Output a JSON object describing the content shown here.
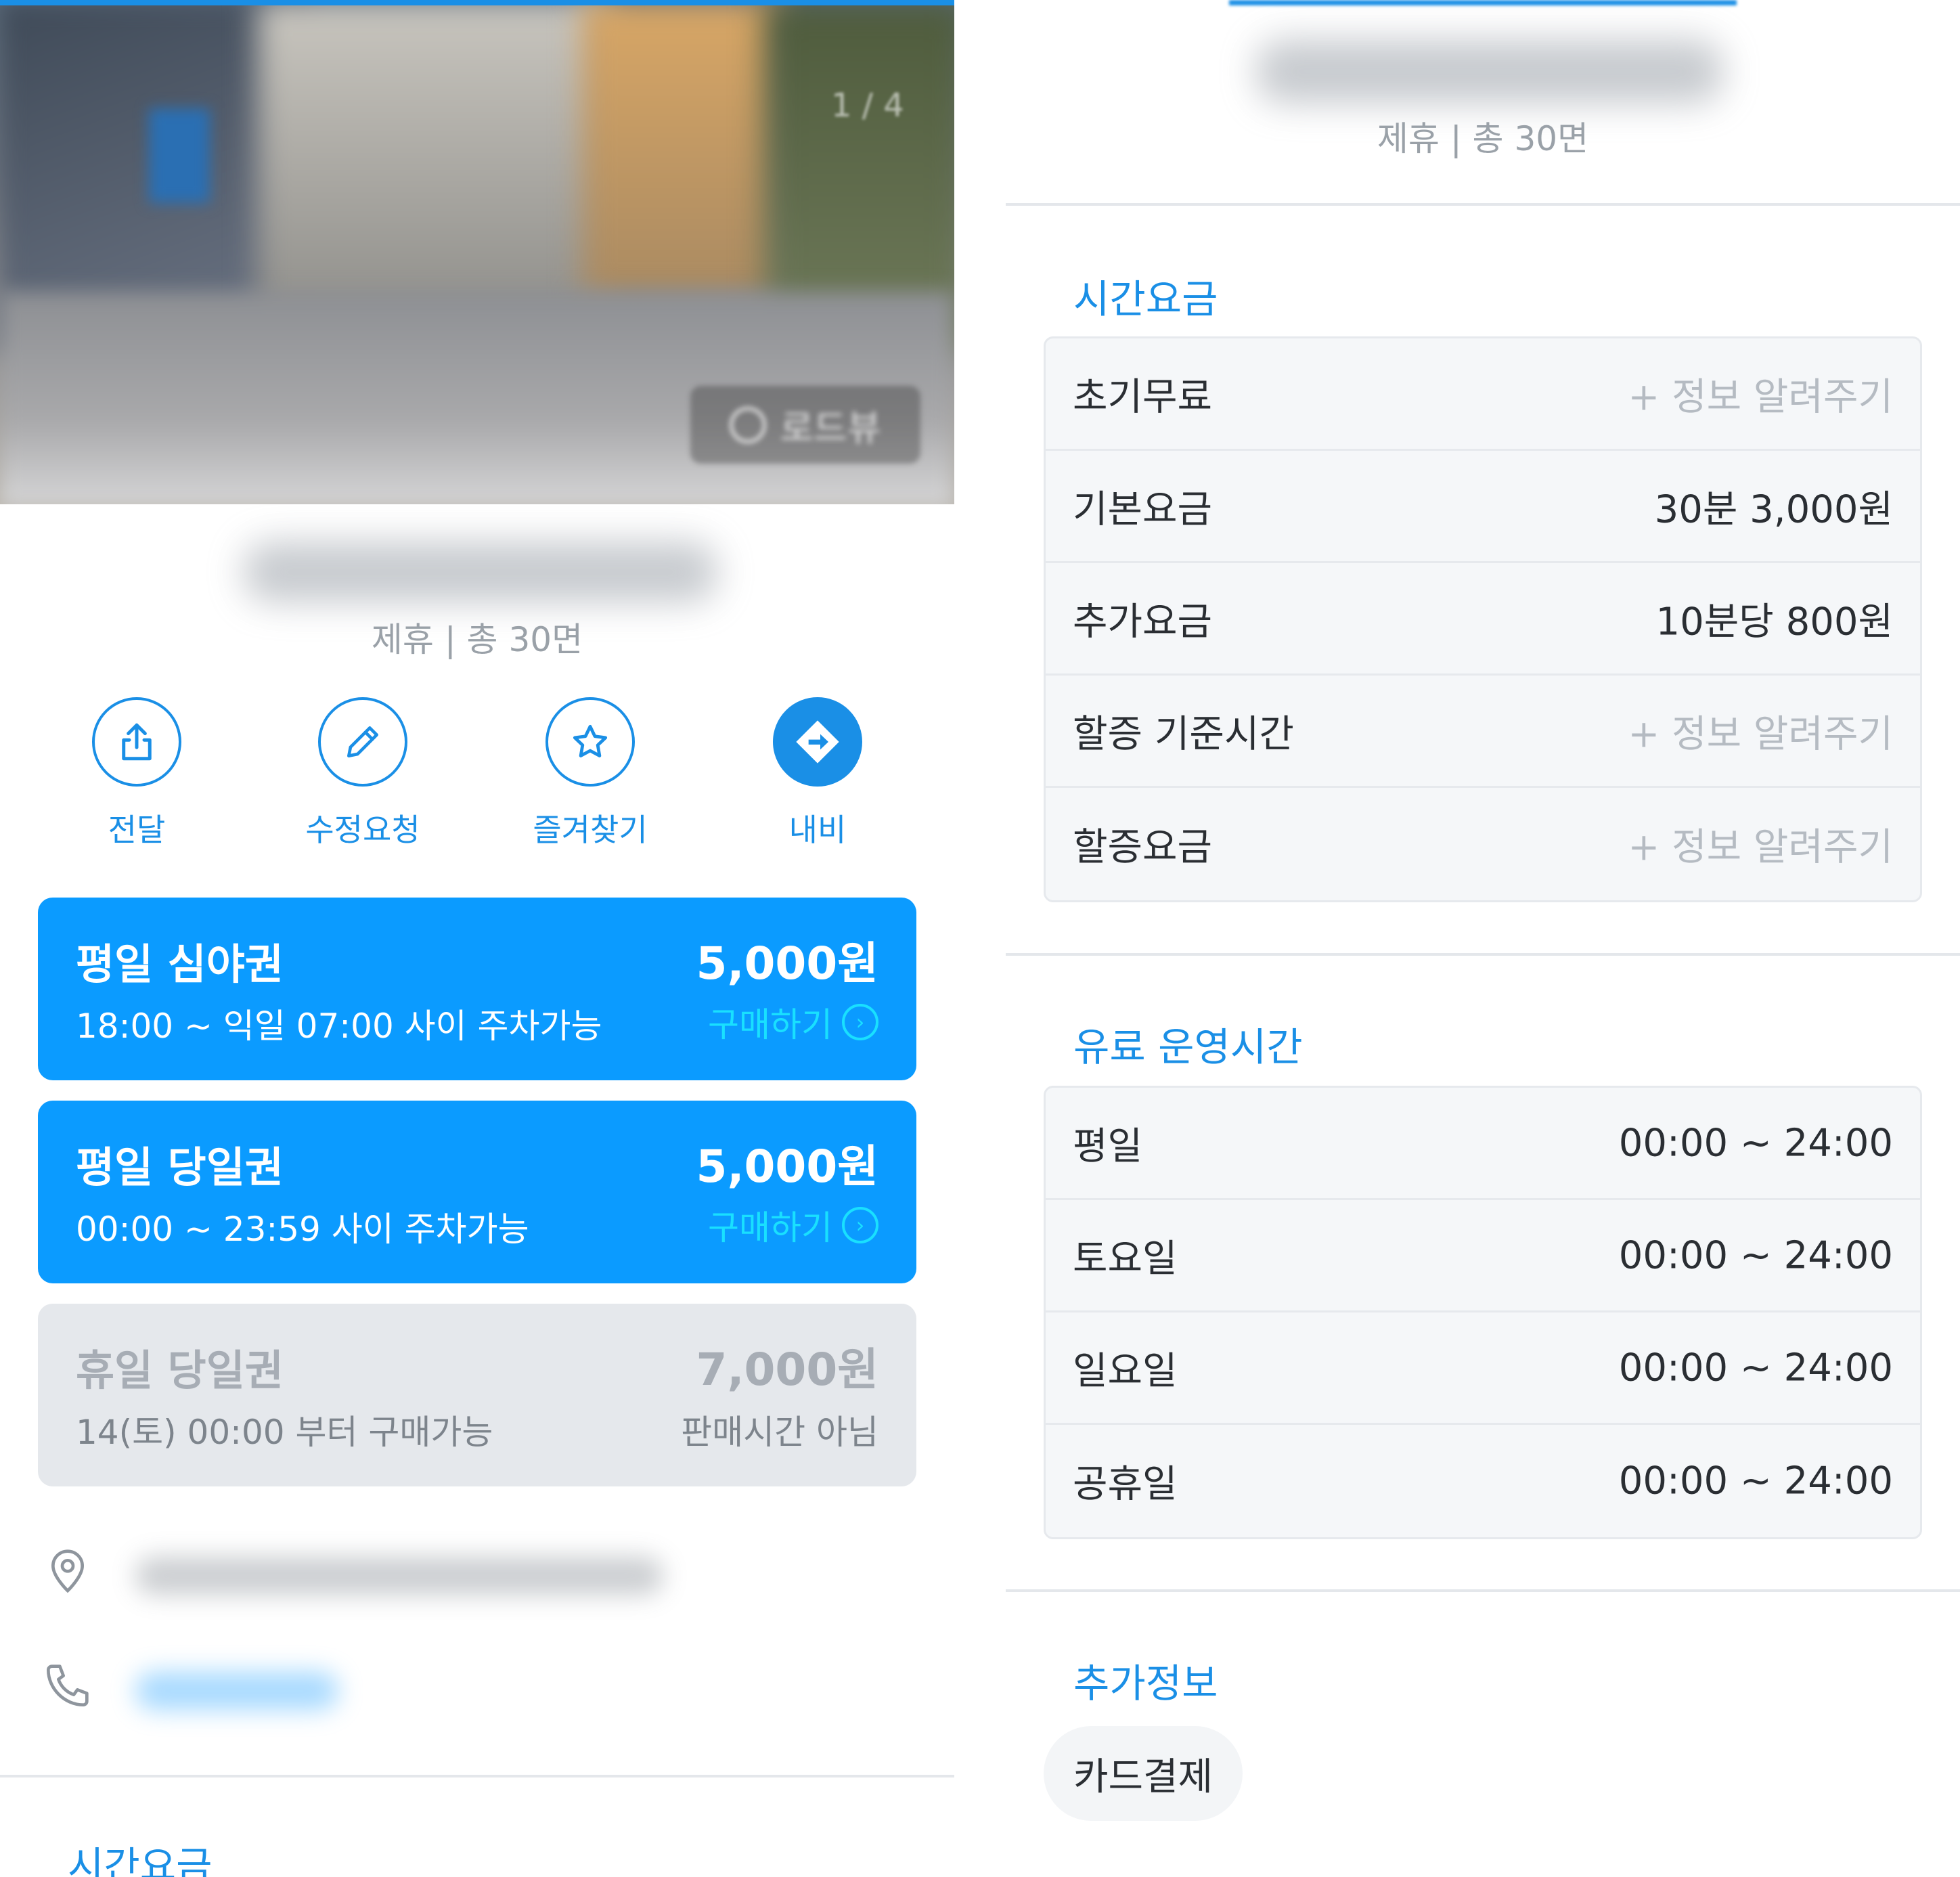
{
  "left": {
    "photo": {
      "counter": "1 / 4",
      "roadview_label": "로드뷰"
    },
    "summary": "제휴 | 총 30면",
    "actions": [
      {
        "label": "전달",
        "icon": "share-icon"
      },
      {
        "label": "수정요청",
        "icon": "pencil-icon"
      },
      {
        "label": "즐겨찾기",
        "icon": "star-icon"
      },
      {
        "label": "내비",
        "icon": "navigation-icon"
      }
    ],
    "tickets": [
      {
        "name": "평일 심야권",
        "price": "5,000원",
        "desc": "18:00 ~ 익일 07:00 사이 주차가능",
        "action": "구매하기",
        "available": true
      },
      {
        "name": "평일 당일권",
        "price": "5,000원",
        "desc": "00:00 ~ 23:59 사이 주차가능",
        "action": "구매하기",
        "available": true
      },
      {
        "name": "휴일 당일권",
        "price": "7,000원",
        "desc": "14(토) 00:00 부터 구매가능",
        "action": "판매시간 아님",
        "available": false
      }
    ],
    "next_section_title": "시간요금"
  },
  "right": {
    "summary": "제휴 | 총 30면",
    "time_fee": {
      "title": "시간요금",
      "rows": [
        {
          "label": "초기무료",
          "value": "+ 정보 알려주기",
          "muted": true
        },
        {
          "label": "기본요금",
          "value": "30분 3,000원",
          "muted": false
        },
        {
          "label": "추가요금",
          "value": "10분당 800원",
          "muted": false
        },
        {
          "label": "할증 기준시간",
          "value": "+ 정보 알려주기",
          "muted": true
        },
        {
          "label": "할증요금",
          "value": "+ 정보 알려주기",
          "muted": true
        }
      ]
    },
    "operating_hours": {
      "title": "유료 운영시간",
      "rows": [
        {
          "label": "평일",
          "value": "00:00 ~ 24:00"
        },
        {
          "label": "토요일",
          "value": "00:00 ~ 24:00"
        },
        {
          "label": "일요일",
          "value": "00:00 ~ 24:00"
        },
        {
          "label": "공휴일",
          "value": "00:00 ~ 24:00"
        }
      ]
    },
    "extra_info": {
      "title": "추가정보",
      "chips": [
        "카드결제"
      ]
    }
  },
  "colors": {
    "accent": "#1a8fe6",
    "ticket_active": "#0b9bff",
    "ticket_inactive": "#e5e8ec",
    "buy_link": "#19e0ff"
  }
}
